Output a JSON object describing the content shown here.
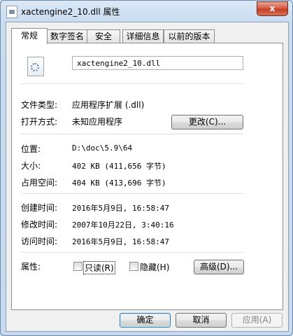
{
  "window": {
    "title": "xactengine2_10.dll 属性",
    "close_symbol": "x"
  },
  "tabs": [
    {
      "label": "常规",
      "active": true
    },
    {
      "label": "数字签名"
    },
    {
      "label": "安全"
    },
    {
      "label": "详细信息"
    },
    {
      "label": "以前的版本"
    }
  ],
  "general": {
    "file_name": "xactengine2_10.dll",
    "file_type": {
      "label": "文件类型:",
      "value": "应用程序扩展 (.dll)"
    },
    "opens_with": {
      "label": "打开方式:",
      "value": "未知应用程序",
      "change_button": "更改(C)..."
    },
    "location": {
      "label": "位置:",
      "value": "D:\\doc\\5.9\\64"
    },
    "size": {
      "label": "大小:",
      "value": "402 KB (411,656 字节)"
    },
    "size_on_disk": {
      "label": "占用空间:",
      "value": "404 KB (413,696 字节)"
    },
    "created": {
      "label": "创建时间:",
      "value": "2016年5月9日, 16:58:47"
    },
    "modified": {
      "label": "修改时间:",
      "value": "2007年10月22日, 3:40:16"
    },
    "accessed": {
      "label": "访问时间:",
      "value": "2016年5月9日, 16:58:47"
    },
    "attributes": {
      "label": "属性:",
      "readonly": "只读(R)",
      "hidden": "隐藏(H)",
      "advanced_button": "高级(D)..."
    }
  },
  "footer": {
    "ok": "确定",
    "cancel": "取消",
    "apply": "应用(A)"
  }
}
